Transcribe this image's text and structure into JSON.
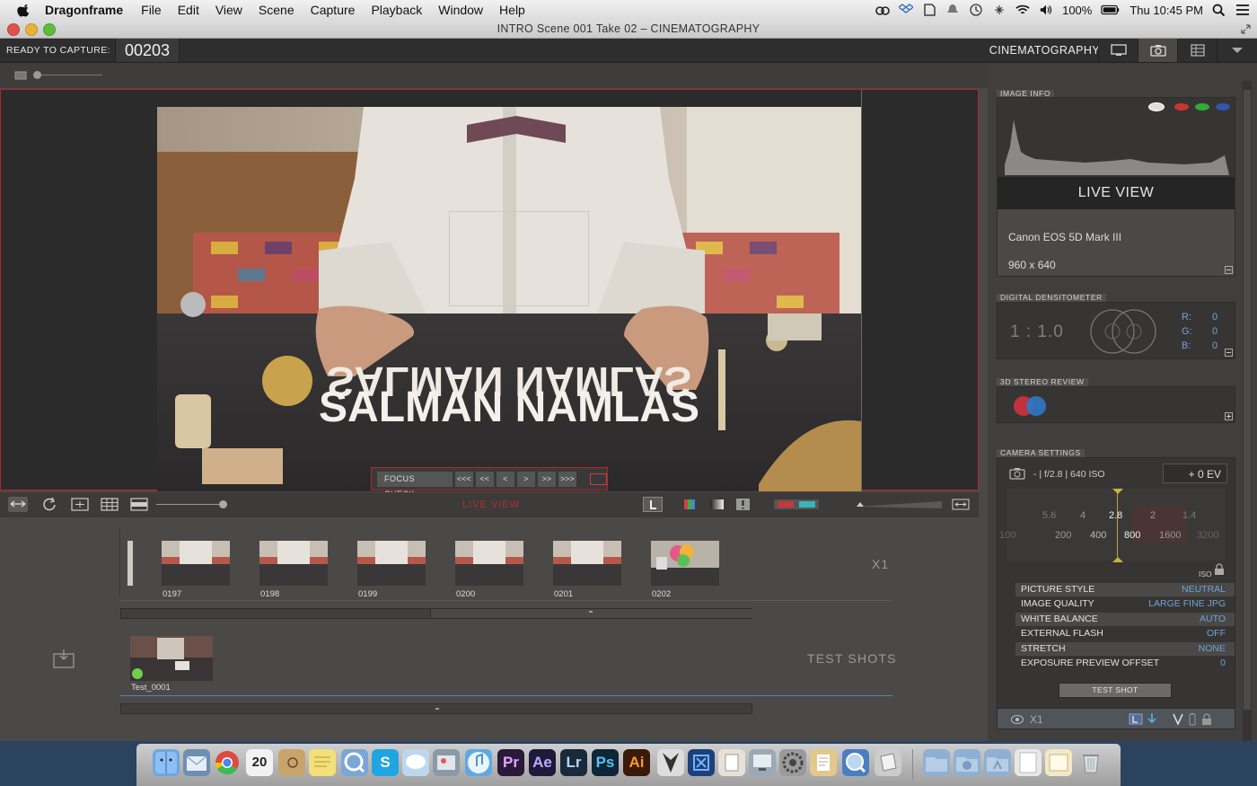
{
  "menubar": {
    "app": "Dragonframe",
    "menus": [
      "File",
      "Edit",
      "View",
      "Scene",
      "Capture",
      "Playback",
      "Window",
      "Help"
    ],
    "battery": "100%",
    "clock": "Thu 10:45 PM"
  },
  "window": {
    "title": "INTRO  Scene 001  Take 02 – CINEMATOGRAPHY"
  },
  "topbar": {
    "status_label": "READY TO CAPTURE:",
    "frame_number": "00203",
    "workspace": "CINEMATOGRAPHY"
  },
  "viewer": {
    "focus_check": "FOCUS CHECK",
    "nav": [
      "<<<",
      "<<",
      "<",
      ">",
      ">>",
      ">>>"
    ],
    "mode_label": "LIVE VIEW",
    "letters": "SALMAN NAMLAS"
  },
  "timeline": {
    "frames": [
      "0197",
      "0198",
      "0199",
      "0200",
      "0201",
      "0202"
    ],
    "exposure_label": "X1",
    "test_shots_label": "TEST SHOTS",
    "test_shot_name": "Test_0001"
  },
  "panel": {
    "image_info": {
      "title": "IMAGE INFO",
      "mode": "LIVE VIEW",
      "camera": "Canon EOS 5D Mark III",
      "resolution": "960 x 640"
    },
    "densitometer": {
      "title": "DIGITAL DENSITOMETER",
      "ratio": "1 : 1.0",
      "r": "0",
      "g": "0",
      "b": "0"
    },
    "stereo": {
      "title": "3D STEREO REVIEW"
    },
    "camera_settings": {
      "title": "CAMERA SETTINGS",
      "summary": "- | f/2.8 | 640 ISO",
      "ev": "+ 0 EV",
      "apertures": [
        "5.6",
        "4",
        "2.8",
        "2",
        "1.4"
      ],
      "iso_values": [
        "100",
        "200",
        "400",
        "800",
        "1600",
        "3200"
      ],
      "iso_label": "ISO",
      "rows": [
        {
          "label": "PICTURE STYLE",
          "value": "NEUTRAL"
        },
        {
          "label": "IMAGE QUALITY",
          "value": "LARGE FINE JPG"
        },
        {
          "label": "WHITE BALANCE",
          "value": "AUTO"
        },
        {
          "label": "EXTERNAL FLASH",
          "value": "OFF"
        },
        {
          "label": "STRETCH",
          "value": "NONE"
        },
        {
          "label": "EXPOSURE PREVIEW OFFSET",
          "value": "0"
        }
      ],
      "test_shot_button": "TEST SHOT",
      "footer_exposure": "X1"
    }
  },
  "dock": {
    "apps": [
      "Pr",
      "Ae",
      "Lr",
      "Ps",
      "Ai"
    ],
    "calendar_day": "20"
  },
  "colors": {
    "accent_red": "#b2272b",
    "value_blue": "#6fa3d6",
    "panel_bg": "#403f3e"
  }
}
